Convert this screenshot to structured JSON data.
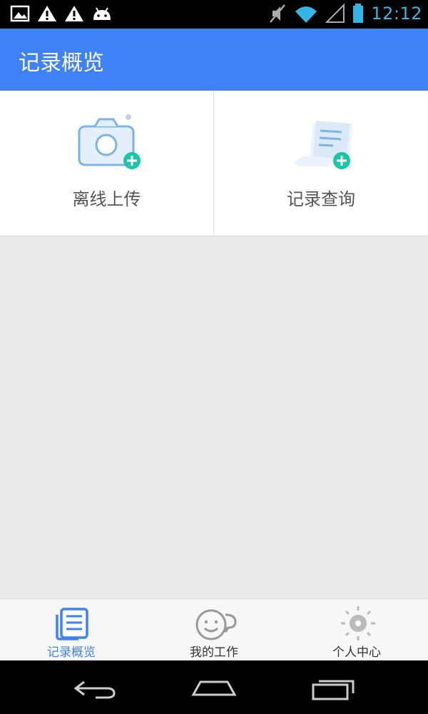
{
  "status_bar": {
    "time": "12:12",
    "left_icons": [
      "image-icon",
      "warning-icon",
      "warning-icon",
      "android-icon"
    ],
    "right_icons": [
      "mute-icon",
      "wifi-icon",
      "signal-icon",
      "battery-icon"
    ],
    "time_color": "#33b5e5"
  },
  "app_bar": {
    "title": "记录概览",
    "color": "#3f81f7"
  },
  "grid": {
    "items": [
      {
        "label": "离线上传",
        "icon": "camera-add-icon"
      },
      {
        "label": "记录查询",
        "icon": "document-add-icon"
      }
    ]
  },
  "bottom_nav": {
    "items": [
      {
        "label": "记录概览",
        "icon": "records-icon",
        "active": true
      },
      {
        "label": "我的工作",
        "icon": "smiley-chat-icon",
        "active": false
      },
      {
        "label": "个人中心",
        "icon": "sun-icon",
        "active": false
      }
    ]
  },
  "system_nav": {
    "buttons": [
      "back-icon",
      "home-icon",
      "recent-apps-icon"
    ]
  }
}
